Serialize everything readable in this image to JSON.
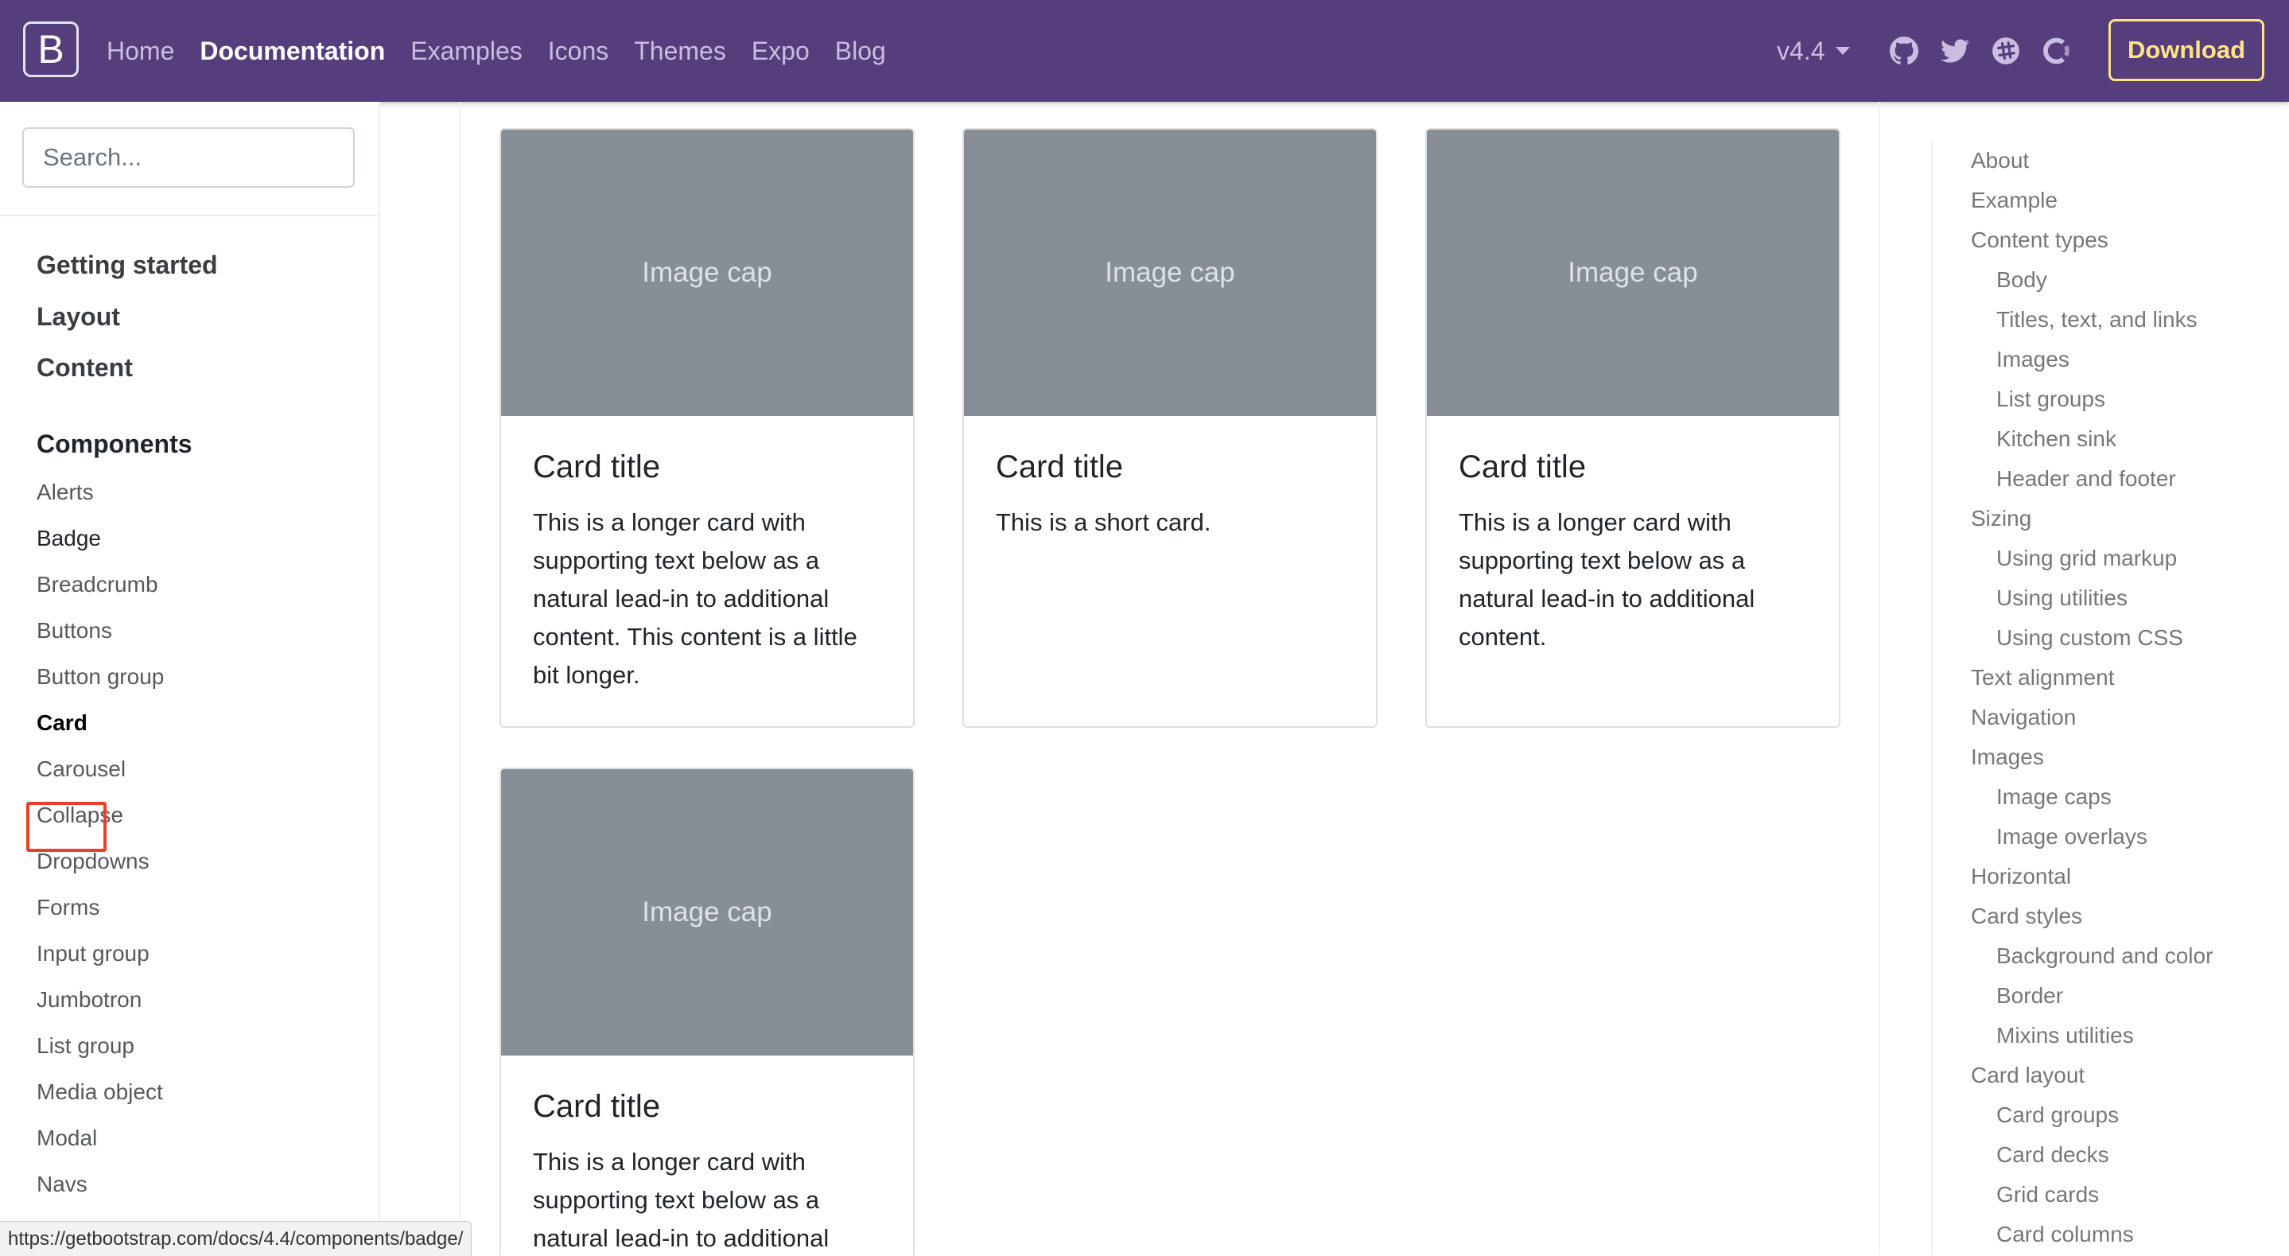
{
  "navbar": {
    "brand": "B",
    "links": [
      "Home",
      "Documentation",
      "Examples",
      "Icons",
      "Themes",
      "Expo",
      "Blog"
    ],
    "active_link": "Documentation",
    "version": "v4.4",
    "icons": [
      "github-icon",
      "twitter-icon",
      "slack-icon",
      "opencollective-icon"
    ],
    "download": "Download",
    "colors": {
      "background": "#563d7c",
      "download": "#ffe484"
    }
  },
  "search": {
    "placeholder": "Search..."
  },
  "sidebar": {
    "sections": [
      "Getting started",
      "Layout",
      "Content",
      "Components"
    ],
    "component_items": [
      "Alerts",
      "Badge",
      "Breadcrumb",
      "Buttons",
      "Button group",
      "Card",
      "Carousel",
      "Collapse",
      "Dropdowns",
      "Forms",
      "Input group",
      "Jumbotron",
      "List group",
      "Media object",
      "Modal",
      "Navs"
    ],
    "active_item": "Card",
    "highlight_color": "#e8412b"
  },
  "cards": [
    {
      "image_cap": "Image cap",
      "title": "Card title",
      "text": "This is a longer card with supporting text below as a natural lead-in to additional content. This content is a little bit longer."
    },
    {
      "image_cap": "Image cap",
      "title": "Card title",
      "text": "This is a short card."
    },
    {
      "image_cap": "Image cap",
      "title": "Card title",
      "text": "This is a longer card with supporting text below as a natural lead-in to additional content."
    },
    {
      "image_cap": "Image cap",
      "title": "Card title",
      "text": "This is a longer card with supporting text below as a natural lead-in to additional"
    }
  ],
  "toc": [
    {
      "label": "About",
      "sub": false
    },
    {
      "label": "Example",
      "sub": false
    },
    {
      "label": "Content types",
      "sub": false
    },
    {
      "label": "Body",
      "sub": true
    },
    {
      "label": "Titles, text, and links",
      "sub": true
    },
    {
      "label": "Images",
      "sub": true
    },
    {
      "label": "List groups",
      "sub": true
    },
    {
      "label": "Kitchen sink",
      "sub": true
    },
    {
      "label": "Header and footer",
      "sub": true
    },
    {
      "label": "Sizing",
      "sub": false
    },
    {
      "label": "Using grid markup",
      "sub": true
    },
    {
      "label": "Using utilities",
      "sub": true
    },
    {
      "label": "Using custom CSS",
      "sub": true
    },
    {
      "label": "Text alignment",
      "sub": false
    },
    {
      "label": "Navigation",
      "sub": false
    },
    {
      "label": "Images",
      "sub": false
    },
    {
      "label": "Image caps",
      "sub": true
    },
    {
      "label": "Image overlays",
      "sub": true
    },
    {
      "label": "Horizontal",
      "sub": false
    },
    {
      "label": "Card styles",
      "sub": false
    },
    {
      "label": "Background and color",
      "sub": true
    },
    {
      "label": "Border",
      "sub": true
    },
    {
      "label": "Mixins utilities",
      "sub": true
    },
    {
      "label": "Card layout",
      "sub": false
    },
    {
      "label": "Card groups",
      "sub": true
    },
    {
      "label": "Card decks",
      "sub": true
    },
    {
      "label": "Grid cards",
      "sub": true
    },
    {
      "label": "Card columns",
      "sub": true
    }
  ],
  "status_url": "https://getbootstrap.com/docs/4.4/components/badge/"
}
